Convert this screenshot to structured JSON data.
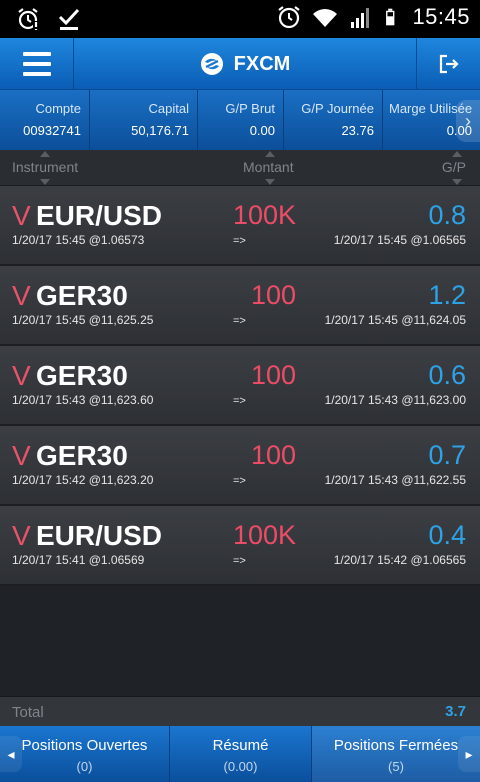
{
  "status_bar": {
    "time": "15:45",
    "left_icons": [
      "alarm-notification-icon",
      "download-done-icon"
    ],
    "right_icons": [
      "alarm-clock-icon",
      "wifi-icon",
      "signal-icon",
      "battery-icon"
    ]
  },
  "header": {
    "title": "FXCM",
    "menu_icon": "hamburger-menu-icon",
    "logout_icon": "logout-icon"
  },
  "account": {
    "columns": [
      {
        "label": "Compte",
        "value": "00932741"
      },
      {
        "label": "Capital",
        "value": "50,176.71"
      },
      {
        "label": "G/P Brut",
        "value": "0.00"
      },
      {
        "label": "G/P Journée",
        "value": "23.76"
      },
      {
        "label": "Marge Utilisée",
        "value": "0.00"
      }
    ]
  },
  "table": {
    "headers": {
      "instrument": "Instrument",
      "amount": "Montant",
      "pl": "G/P"
    },
    "rows": [
      {
        "side": "V",
        "symbol": "EUR/USD",
        "amount": "100K",
        "pl": "0.8",
        "open": "1/20/17 15:45 @1.06573",
        "arrow": "=>",
        "close": "1/20/17 15:45 @1.06565"
      },
      {
        "side": "V",
        "symbol": "GER30",
        "amount": "100",
        "pl": "1.2",
        "open": "1/20/17 15:45 @11,625.25",
        "arrow": "=>",
        "close": "1/20/17 15:45 @11,624.05"
      },
      {
        "side": "V",
        "symbol": "GER30",
        "amount": "100",
        "pl": "0.6",
        "open": "1/20/17 15:43 @11,623.60",
        "arrow": "=>",
        "close": "1/20/17 15:43 @11,623.00"
      },
      {
        "side": "V",
        "symbol": "GER30",
        "amount": "100",
        "pl": "0.7",
        "open": "1/20/17 15:42 @11,623.20",
        "arrow": "=>",
        "close": "1/20/17 15:43 @11,622.55"
      },
      {
        "side": "V",
        "symbol": "EUR/USD",
        "amount": "100K",
        "pl": "0.4",
        "open": "1/20/17 15:41 @1.06569",
        "arrow": "=>",
        "close": "1/20/17 15:42 @1.06565"
      }
    ],
    "total_label": "Total",
    "total_value": "3.7"
  },
  "tabs": [
    {
      "label": "Positions Ouvertes",
      "count": "(0)"
    },
    {
      "label": "Résumé",
      "count": "(0.00)"
    },
    {
      "label": "Positions Fermées",
      "count": "(5)"
    }
  ],
  "colors": {
    "accent_blue": "#1a76cf",
    "sell_red": "#ec4c67",
    "profit_blue": "#2ea2e6"
  }
}
